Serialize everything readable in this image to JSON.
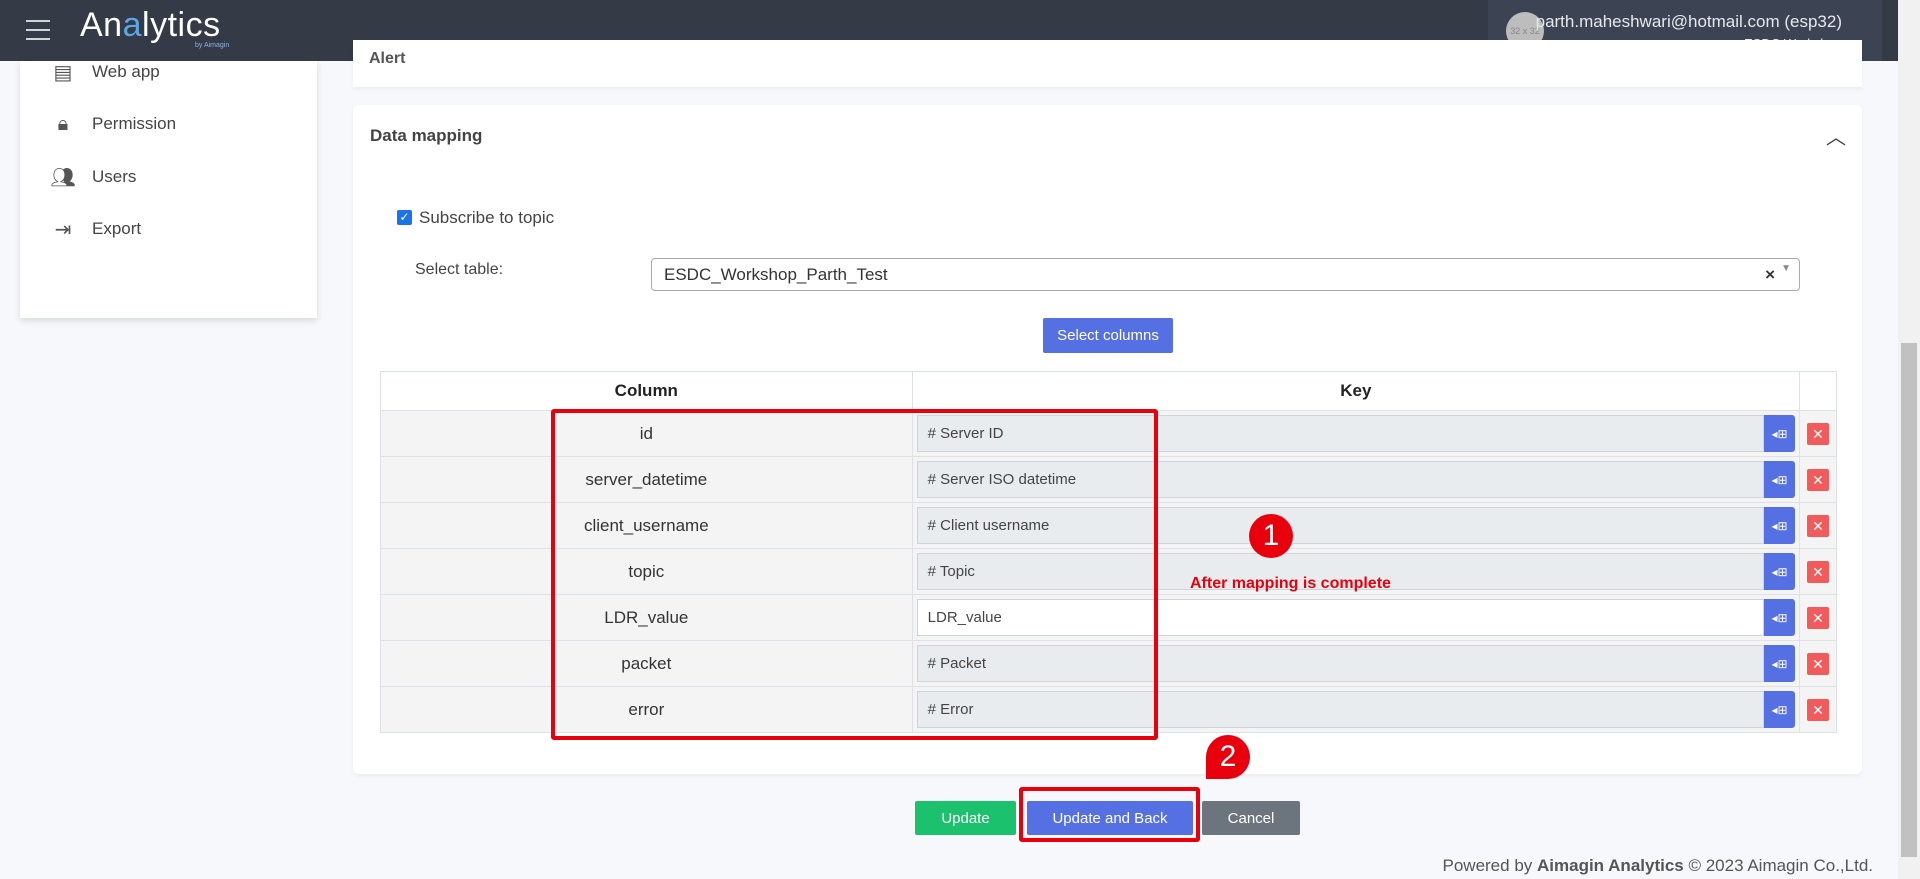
{
  "header": {
    "logo": "Analytics",
    "logo_highlight": "a",
    "logo_sub": "by Aimagin",
    "avatar_text": "32 x 32",
    "email": "parth.maheshwari@hotmail.com (esp32)",
    "workspace": "ESDC Workshop"
  },
  "sidebar": {
    "items": [
      {
        "label": "Web app",
        "icon": "server-icon"
      },
      {
        "label": "Permission",
        "icon": "lock-icon"
      },
      {
        "label": "Users",
        "icon": "users-icon"
      },
      {
        "label": "Export",
        "icon": "export-icon"
      }
    ]
  },
  "alert": {
    "title": "Alert"
  },
  "mapping": {
    "title": "Data mapping",
    "subscribe_label": "Subscribe to topic",
    "subscribe_checked": true,
    "select_label": "Select table:",
    "selected_table": "ESDC_Workshop_Parth_Test",
    "select_columns": "Select columns",
    "headers": {
      "column": "Column",
      "key": "Key"
    },
    "rows": [
      {
        "column": "id",
        "key": "# Server ID"
      },
      {
        "column": "server_datetime",
        "key": "# Server ISO datetime"
      },
      {
        "column": "client_username",
        "key": "# Client username"
      },
      {
        "column": "topic",
        "key": "# Topic"
      },
      {
        "column": "LDR_value",
        "key": "LDR_value"
      },
      {
        "column": "packet",
        "key": "# Packet"
      },
      {
        "column": "error",
        "key": "# Error"
      }
    ]
  },
  "annotations": {
    "step1": "1",
    "step1_text": "After mapping is complete",
    "step2": "2",
    "color": "#e8000d"
  },
  "actions": {
    "update": "Update",
    "update_back": "Update and Back",
    "cancel": "Cancel"
  },
  "footer": {
    "prefix": "Powered by ",
    "brand": "Aimagin Analytics",
    "suffix": " © 2023 Aimagin Co.,Ltd."
  }
}
